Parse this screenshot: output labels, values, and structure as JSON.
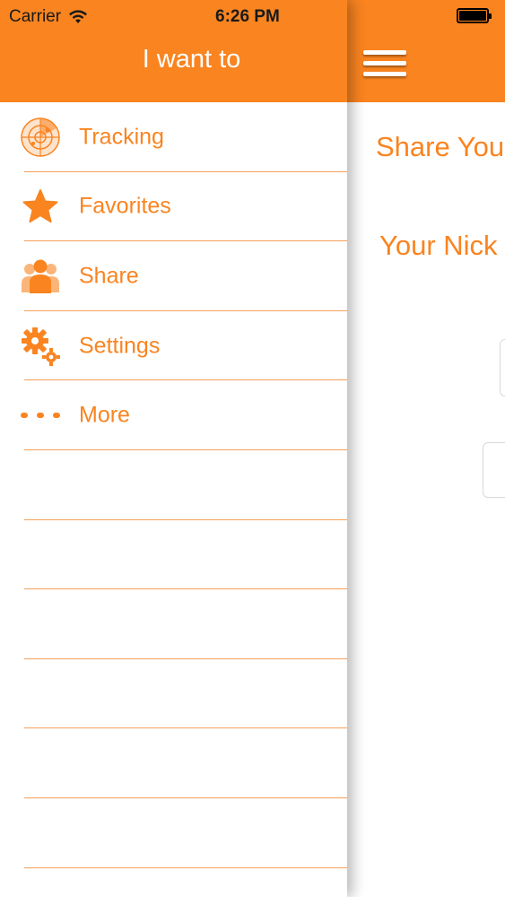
{
  "status_bar": {
    "carrier": "Carrier",
    "time": "6:26 PM"
  },
  "drawer": {
    "title": "I want to",
    "items": [
      {
        "label": "Tracking",
        "icon": "radar-icon"
      },
      {
        "label": "Favorites",
        "icon": "star-icon"
      },
      {
        "label": "Share",
        "icon": "people-icon"
      },
      {
        "label": "Settings",
        "icon": "gears-icon"
      },
      {
        "label": "More",
        "icon": "more-dots-icon"
      }
    ],
    "empty_rows": 6
  },
  "main": {
    "title": "Share You",
    "nickname_label": "Your Nick"
  },
  "colors": {
    "accent": "#f98420",
    "divider": "#f5a05a",
    "background": "#ffffff"
  }
}
